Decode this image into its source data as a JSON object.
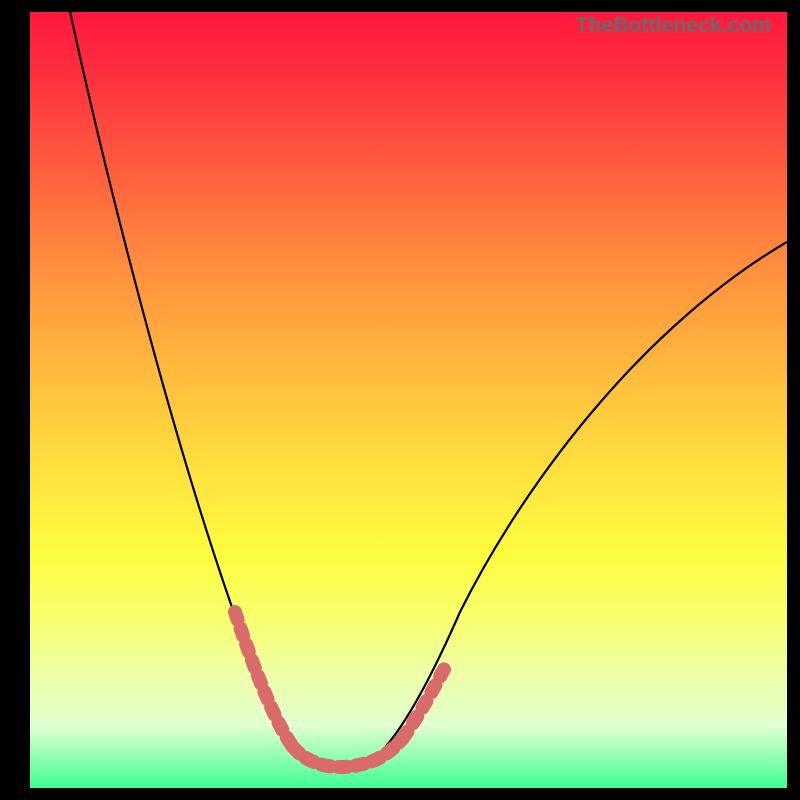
{
  "watermark": "TheBottleneck.com",
  "chart_data": {
    "type": "line",
    "title": "",
    "xlabel": "",
    "ylabel": "",
    "x": [
      0.0,
      0.05,
      0.1,
      0.15,
      0.2,
      0.25,
      0.28,
      0.31,
      0.34,
      0.37,
      0.4,
      0.43,
      0.46,
      0.5,
      0.55,
      0.6,
      0.65,
      0.7,
      0.75,
      0.8,
      0.85,
      0.9,
      0.95,
      1.0
    ],
    "y": [
      1.0,
      0.86,
      0.72,
      0.58,
      0.45,
      0.32,
      0.24,
      0.16,
      0.09,
      0.04,
      0.01,
      0.01,
      0.03,
      0.09,
      0.19,
      0.28,
      0.36,
      0.43,
      0.49,
      0.55,
      0.6,
      0.64,
      0.68,
      0.71
    ],
    "xlim": [
      0,
      1
    ],
    "ylim": [
      0,
      1
    ],
    "highlighted_segments": [
      {
        "x_start": 0.26,
        "x_end": 0.33
      },
      {
        "x_start": 0.33,
        "x_end": 0.46
      },
      {
        "x_start": 0.46,
        "x_end": 0.52
      }
    ],
    "colors": {
      "curve": "#000000",
      "highlight": "#d96b6b",
      "background_gradient": [
        "#ff183e",
        "#fdfd3e",
        "#3fff93"
      ]
    }
  }
}
